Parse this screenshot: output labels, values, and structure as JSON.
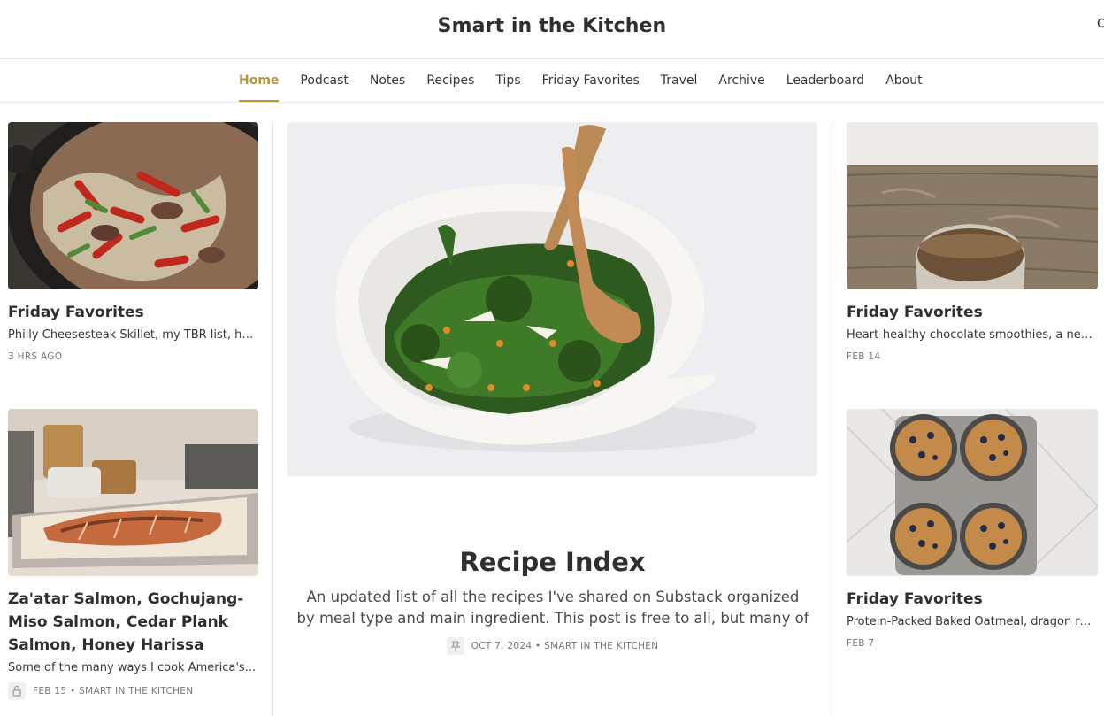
{
  "header": {
    "title": "Smart in the Kitchen"
  },
  "nav": {
    "items": [
      {
        "label": "Home",
        "active": true
      },
      {
        "label": "Podcast"
      },
      {
        "label": "Notes"
      },
      {
        "label": "Recipes"
      },
      {
        "label": "Tips"
      },
      {
        "label": "Friday Favorites"
      },
      {
        "label": "Travel"
      },
      {
        "label": "Archive"
      },
      {
        "label": "Leaderboard"
      },
      {
        "label": "About"
      }
    ]
  },
  "posts": {
    "left1": {
      "title": "Friday Favorites",
      "subtitle": "Philly Cheesesteak Skillet, my TBR list, happ...",
      "meta": "3 HRS AGO"
    },
    "left2": {
      "title": "Za'atar Salmon, Gochujang-Miso Salmon, Cedar Plank Salmon, Honey Harissa Salmo...",
      "subtitle": "Some of the many ways I cook America's...",
      "meta": "FEB 15 • SMART IN THE KITCHEN"
    },
    "center": {
      "title": "Recipe Index",
      "subtitle": "An updated list of all the recipes I've shared on Substack organized by meal type and main ingredient. This post is free to all, but many of the recipes...",
      "meta": "OCT 7, 2024 • SMART IN THE KITCHEN"
    },
    "right1": {
      "title": "Friday Favorites",
      "subtitle": "Heart-healthy chocolate smoothies, a new...",
      "meta": "FEB 14"
    },
    "right2": {
      "title": "Friday Favorites",
      "subtitle": "Protein-Packed Baked Oatmeal, dragon rea...",
      "meta": "FEB 7"
    }
  },
  "colors": {
    "accent": "#b6953d",
    "text": "#363737",
    "divider": "#e6e6e6"
  }
}
